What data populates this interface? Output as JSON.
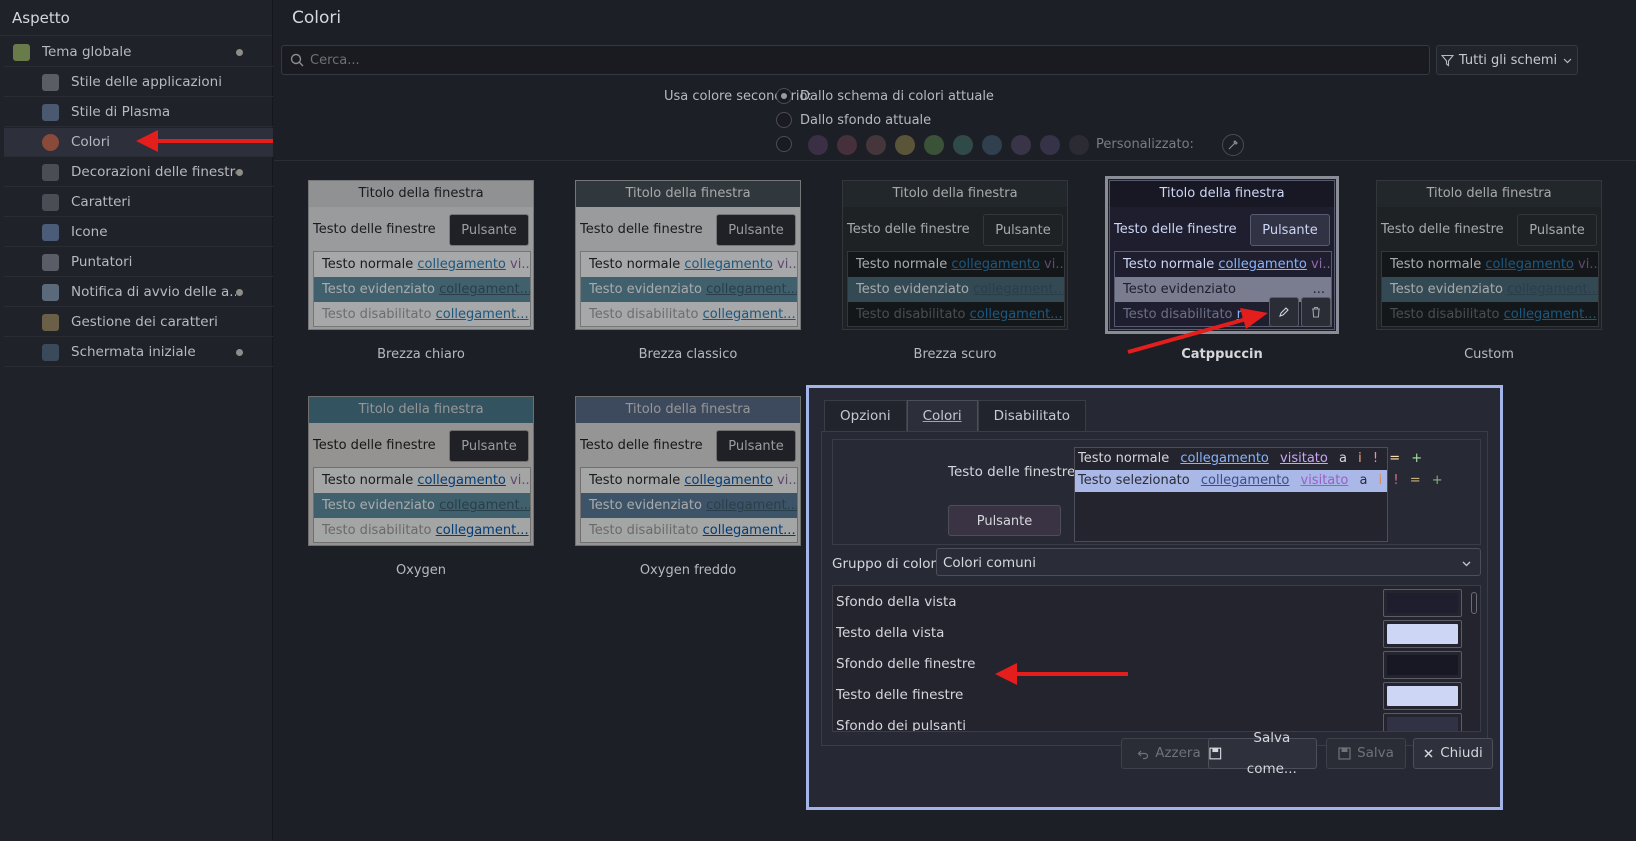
{
  "sidebar": {
    "title": "Aspetto",
    "items": [
      {
        "label": "Tema globale",
        "icon": "global-theme-icon",
        "dot": true
      },
      {
        "label": "Stile delle applicazioni",
        "icon": "app-style-icon",
        "dot": false
      },
      {
        "label": "Stile di Plasma",
        "icon": "plasma-style-icon",
        "dot": false
      },
      {
        "label": "Colori",
        "icon": "colors-icon",
        "dot": false,
        "selected": true
      },
      {
        "label": "Decorazioni delle finestre",
        "icon": "window-decorations-icon",
        "dot": true
      },
      {
        "label": "Caratteri",
        "icon": "fonts-icon",
        "dot": false
      },
      {
        "label": "Icone",
        "icon": "icons-icon",
        "dot": false
      },
      {
        "label": "Puntatori",
        "icon": "cursors-icon",
        "dot": false
      },
      {
        "label": "Notifica di avvio delle a...",
        "icon": "launch-feedback-icon",
        "dot": true
      },
      {
        "label": "Gestione dei caratteri",
        "icon": "font-management-icon",
        "dot": false
      },
      {
        "label": "Schermata iniziale",
        "icon": "splash-screen-icon",
        "dot": true
      }
    ]
  },
  "main": {
    "title": "Colori",
    "search_placeholder": "Cerca...",
    "filter_label": "Tutti gli schemi",
    "secondary_label": "Usa colore secondario:",
    "radio_current_scheme": "Dallo schema di colori attuale",
    "radio_wallpaper": "Dallo sfondo attuale",
    "custom_label": "Personalizzato:",
    "accent_swatches": [
      "#3a2f45",
      "#45303b",
      "#44363a",
      "#5a5538",
      "#3a5238",
      "#304a48",
      "#30404e",
      "#3a3448",
      "#363247",
      "#2b2c33"
    ]
  },
  "preview_strings": {
    "title": "Titolo della finestra",
    "window_text": "Testo delle finestre",
    "button": "Pulsante",
    "normal": "Testo normale",
    "link": "collegamento",
    "visited_short": "vi...",
    "highlighted": "Testo evidenziato",
    "link_short": "collegament...",
    "disabled": "Testo disabilitato",
    "ellipsis": "...",
    "partial": "n"
  },
  "schemes": [
    {
      "name": "Brezza chiaro"
    },
    {
      "name": "Brezza classico"
    },
    {
      "name": "Brezza scuro"
    },
    {
      "name": "Catppuccin",
      "current": true
    },
    {
      "name": "Custom"
    },
    {
      "name": "Oxygen"
    },
    {
      "name": "Oxygen freddo"
    }
  ],
  "dialog": {
    "tabs": [
      "Opzioni",
      "Colori",
      "Disabilitato"
    ],
    "active_tab": "Colori",
    "preview_label": "Testo delle finestre",
    "preview_button": "Pulsante",
    "preview_rows": [
      {
        "text": "Testo normale",
        "link": "collegamento",
        "visited": "visitato",
        "a": "a",
        "i": "i",
        "bang": "!",
        "eq": "=",
        "plus": "+"
      },
      {
        "text": "Testo selezionato",
        "link": "collegamento",
        "visited": "visitato",
        "a": "a",
        "i": "i",
        "bang": "!",
        "eq": "=",
        "plus": "+"
      }
    ],
    "group_label": "Gruppo di colori:",
    "group_value": "Colori comuni",
    "color_roles": [
      {
        "label": "Sfondo della vista",
        "color": "#1e1e2e"
      },
      {
        "label": "Testo della vista",
        "color": "#cdd6f4"
      },
      {
        "label": "Sfondo delle finestre",
        "color": "#181825"
      },
      {
        "label": "Testo delle finestre",
        "color": "#cdd6f4"
      },
      {
        "label": "Sfondo dei pulsanti",
        "color": "#313244"
      }
    ],
    "buttons": {
      "reset": "Azzera",
      "save_as": "Salva come...",
      "save": "Salva",
      "close": "Chiudi"
    }
  }
}
